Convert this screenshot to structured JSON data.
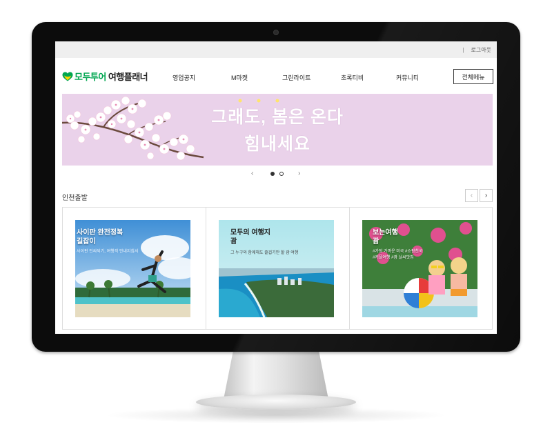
{
  "topbar": {
    "separator": "|",
    "logout_label": "로그아웃"
  },
  "logo": {
    "brand": "모두투어",
    "sub": "여행플래너",
    "icon": "heart-logo-icon",
    "brand_color": "#00a650"
  },
  "nav": {
    "items": [
      "영업공지",
      "M마켓",
      "그린라이트",
      "초록티비",
      "커뮤니티"
    ],
    "all_menu_label": "전체메뉴"
  },
  "banner": {
    "line1": "그래도, 봄은 온다",
    "line2": "힘내세요",
    "background": "#ead2ea",
    "image": "cherry-blossom"
  },
  "pager": {
    "prev": "‹",
    "next": "›",
    "slides": 2,
    "active_index": 0
  },
  "section": {
    "title": "인천출발",
    "prev": "‹",
    "next": "›"
  },
  "cards": [
    {
      "title": "사이판 완전정복\n길잡이",
      "desc": "사이판 인싸되기, 여행객 안내지침서",
      "image": "saipan-beach-jump"
    },
    {
      "title": "모두의 여행지\n괌",
      "desc": "그 누구와 함께해도 즐겁기만 할 괌 여행",
      "image": "guam-aerial-coast"
    },
    {
      "title": "보는여행\n괌",
      "desc": "#가장 가까운 미국 #쇼핑천국\n#커플여행 #괌 날씨맛집",
      "image": "kids-beach-ball"
    }
  ]
}
